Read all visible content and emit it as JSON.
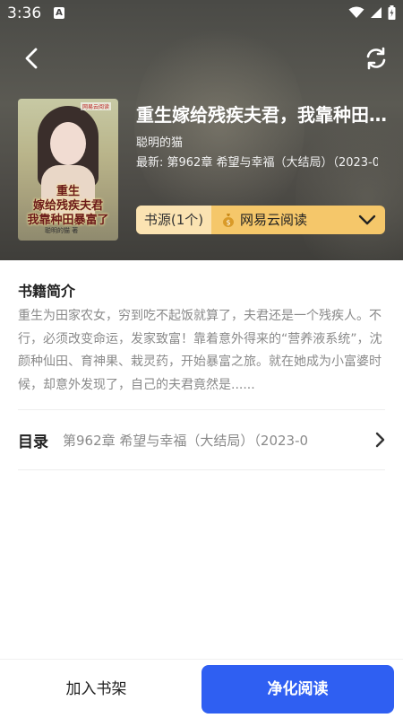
{
  "status_bar": {
    "time": "3:36",
    "notification_letter": "A"
  },
  "book": {
    "title": "重生嫁给残疾夫君，我靠种田暴富了",
    "author": "聪明的猫",
    "latest": "最新: 第962章 希望与幸福（大结局）（2023-0",
    "cover_art": {
      "label_top": "重生",
      "title_line1": "嫁给残疾夫君",
      "title_line2": "我靠种田暴富了",
      "author": "聪明的猫 著",
      "publisher": "网易云阅读"
    }
  },
  "source": {
    "label": "书源(1个)",
    "name": "网易云阅读"
  },
  "summary": {
    "title": "书籍简介",
    "text": "重生为田家农女，穷到吃不起饭就算了，夫君还是一个残疾人。不行，必须改变命运，发家致富！靠着意外得来的“营养液系统”，沈颜种仙田、育神果、栽灵药，开始暴富之旅。就在她成为小富婆时候，却意外发现了，自己的夫君竟然是......"
  },
  "toc": {
    "label": "目录",
    "value": "第962章 希望与幸福（大结局）（2023-0"
  },
  "actions": {
    "add_shelf": "加入书架",
    "read": "净化阅读"
  },
  "colors": {
    "accent": "#2f5ff2",
    "source_bg": "#f5c76a",
    "source_label_bg": "#fbe3b2"
  }
}
